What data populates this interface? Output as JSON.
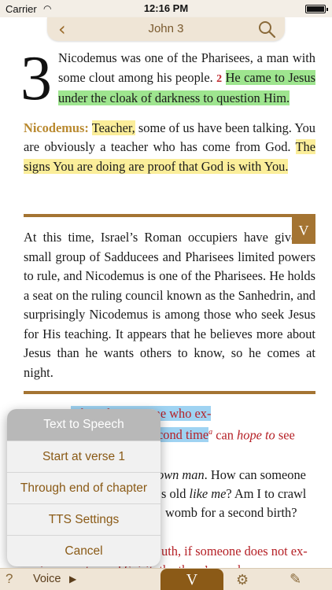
{
  "status_bar": {
    "carrier": "Carrier",
    "time": "12:16 PM"
  },
  "nav": {
    "title": "John 3"
  },
  "passage": {
    "chapter_number": "3",
    "p1_a": "Nicodemus was one of the Pharisees, a man with some clout among his people. ",
    "p1_vnum": "2",
    "p1_hl": "He came to Jesus under the cloak of darkness to question Him.",
    "speaker": "Nicodemus:",
    "p2_hl1": "Teacher,",
    "p2_a": " some of us have been talking. You are obviously a teacher who has come from God. ",
    "p2_hl2": "The signs You are doing are proof that God is with You."
  },
  "note": {
    "badge": "V",
    "text": "At this time, Israel’s Roman occupiers have given a small group of Sadducees and Pharisees limited powers to rule, and Nicodemus is one of the Pharisees. He holds a seat on the ruling council known as the Sanhedrin, and surprisingly Nicodemus is among those who seek Jesus for His teaching. It appears that he believes more about Jesus than he wants others to know, so he comes at night."
  },
  "lower_text": {
    "l1": "uth: only someone who ex-",
    "l2a": "cond time",
    "l2sup": "a",
    "l2b": " can ",
    "l2c": "hope to",
    "l2d": " see",
    "l3a": "own man",
    "l3b": ". How can someone",
    "l4a": "s old ",
    "l4b": "like me",
    "l4c": "? Am I to crawl",
    "l5": "womb for a second birth?",
    "l6": "uth, if someone does not ex-",
    "l7": "perience water and Spirit, the there’s no chance"
  },
  "popup": {
    "title": "Text to Speech",
    "items": [
      "Start at verse 1",
      "Through end of chapter",
      "TTS Settings",
      "Cancel"
    ]
  },
  "toolbar": {
    "help": "?",
    "voice": "Voice",
    "play": "▶",
    "tab": "V",
    "gear": "⚙",
    "pencil": "✎"
  },
  "colors": {
    "accent": "#a47432",
    "green_highlight": "#9ee58f",
    "yellow_highlight": "#fbee9a",
    "blue_highlight": "#9fd3f2",
    "verse_red": "#c0272d"
  }
}
